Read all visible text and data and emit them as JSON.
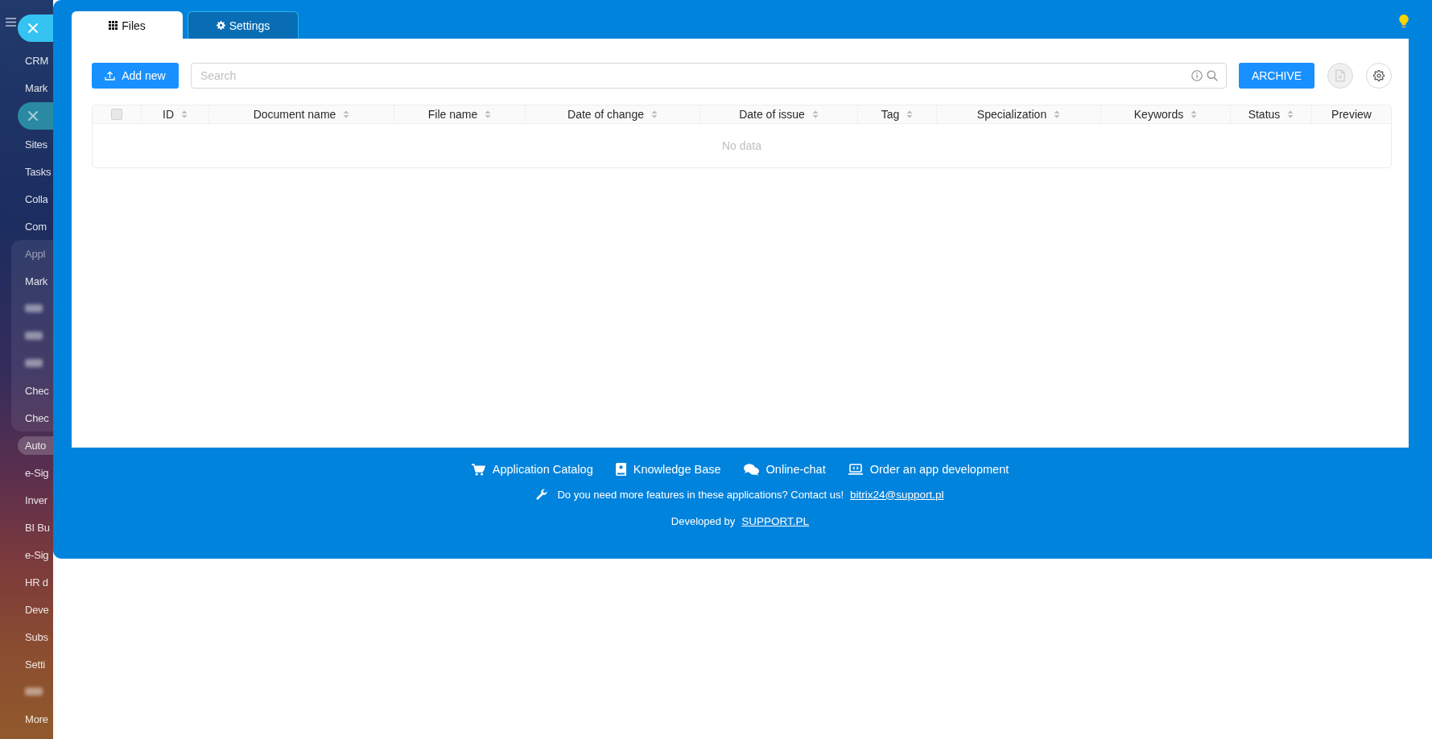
{
  "close_buttons": [
    {
      "active": true
    },
    {
      "active": false
    }
  ],
  "sidebar": {
    "items": [
      {
        "kind": "item",
        "label": "CRM",
        "selected": false
      },
      {
        "kind": "item",
        "label": "Mark",
        "selected": false
      },
      {
        "kind": "item",
        "label": "Sites",
        "selected": false
      },
      {
        "kind": "item",
        "label": "Tasks",
        "selected": false
      },
      {
        "kind": "item",
        "label": "Colla",
        "selected": false
      },
      {
        "kind": "item",
        "label": "Com",
        "selected": false
      },
      {
        "kind": "group",
        "label": "Appl",
        "children": [
          {
            "kind": "item",
            "label": "Mark",
            "selected": false
          },
          {
            "kind": "blurred"
          },
          {
            "kind": "blurred"
          },
          {
            "kind": "blurred"
          },
          {
            "kind": "item",
            "label": "Chec",
            "selected": false
          },
          {
            "kind": "item",
            "label": "Chec",
            "selected": false
          }
        ]
      },
      {
        "kind": "item",
        "label": "Auto",
        "selected": true
      },
      {
        "kind": "item",
        "label": "e-Sig",
        "selected": false
      },
      {
        "kind": "item",
        "label": "Inver",
        "selected": false
      },
      {
        "kind": "item",
        "label": "BI Bu",
        "selected": false
      },
      {
        "kind": "item",
        "label": "e-Sig",
        "selected": false
      },
      {
        "kind": "item",
        "label": "HR d",
        "selected": false
      },
      {
        "kind": "item",
        "label": "Deve",
        "selected": false
      },
      {
        "kind": "item",
        "label": "Subs",
        "selected": false
      },
      {
        "kind": "item",
        "label": "Setti",
        "selected": false
      },
      {
        "kind": "blurred"
      },
      {
        "kind": "item",
        "label": "More",
        "selected": false
      }
    ]
  },
  "tabs": [
    {
      "kind": "files",
      "label": "Files",
      "selected": true
    },
    {
      "kind": "settings",
      "label": "Settings",
      "selected": false
    }
  ],
  "toolbar": {
    "add_button": "Add new",
    "search": {
      "placeholder": "Search"
    },
    "archive_button": "ARCHIVE",
    "export_button": {
      "disabled": true
    }
  },
  "table": {
    "select_all": {
      "checked": false,
      "disabled": true
    },
    "columns": [
      {
        "label": "ID",
        "sortable": true
      },
      {
        "label": "Document name",
        "sortable": true
      },
      {
        "label": "File name",
        "sortable": true
      },
      {
        "label": "Date of change",
        "sortable": true
      },
      {
        "label": "Date of issue",
        "sortable": true
      },
      {
        "label": "Tag",
        "sortable": true
      },
      {
        "label": "Specialization",
        "sortable": true
      },
      {
        "label": "Keywords",
        "sortable": true
      },
      {
        "label": "Status",
        "sortable": true
      },
      {
        "label": "Preview",
        "sortable": false
      }
    ],
    "empty_text": "No data"
  },
  "footer": {
    "links": [
      {
        "kind": "catalog",
        "label": "Application Catalog"
      },
      {
        "kind": "knowledge",
        "label": "Knowledge Base"
      },
      {
        "kind": "chat",
        "label": "Online-chat"
      },
      {
        "kind": "order",
        "label": "Order an app development"
      }
    ],
    "contact": {
      "text": "Do you need more features in these applications? Contact us!",
      "email": "bitrix24@support.pl"
    },
    "credit": {
      "text": "Developed by",
      "link": "SUPPORT.PL"
    }
  }
}
